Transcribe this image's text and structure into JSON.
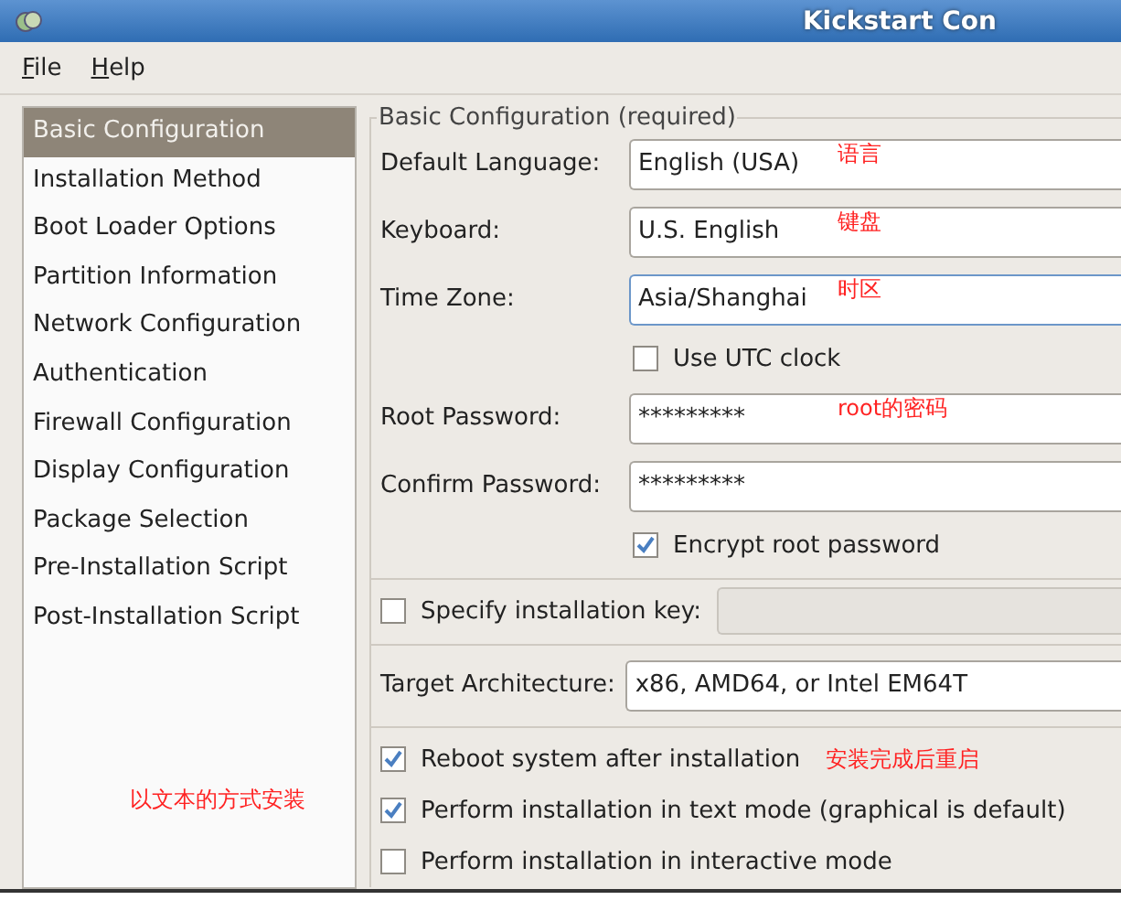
{
  "window": {
    "title": "Kickstart Con"
  },
  "menu": [
    {
      "label": "File"
    },
    {
      "label": "Help"
    }
  ],
  "sidebar": {
    "items": [
      {
        "label": "Basic Configuration",
        "selected": true
      },
      {
        "label": "Installation Method",
        "selected": false
      },
      {
        "label": "Boot Loader Options",
        "selected": false
      },
      {
        "label": "Partition Information",
        "selected": false
      },
      {
        "label": "Network Configuration",
        "selected": false
      },
      {
        "label": "Authentication",
        "selected": false
      },
      {
        "label": "Firewall Configuration",
        "selected": false
      },
      {
        "label": "Display Configuration",
        "selected": false
      },
      {
        "label": "Package Selection",
        "selected": false
      },
      {
        "label": "Pre-Installation Script",
        "selected": false
      },
      {
        "label": "Post-Installation Script",
        "selected": false
      }
    ],
    "note": "以文本的方式安装"
  },
  "section": {
    "title": "Basic Configuration (required)"
  },
  "rows": [
    {
      "kind": "field",
      "label": "Default Language:",
      "value": "English (USA)",
      "note": "语言"
    },
    {
      "kind": "field",
      "label": "Keyboard:",
      "value": "U.S. English",
      "note": "键盘"
    },
    {
      "kind": "field",
      "label": "Time Zone:",
      "value": "Asia/Shanghai",
      "note": "时区",
      "focused": true
    },
    {
      "kind": "subcheck",
      "label": "Use UTC clock",
      "checked": false
    },
    {
      "kind": "field",
      "label": "Root Password:",
      "value": "*********",
      "note": "root的密码"
    },
    {
      "kind": "field",
      "label": "Confirm Password:",
      "value": "*********"
    },
    {
      "kind": "subcheck",
      "label": "Encrypt root password",
      "checked": true
    },
    {
      "kind": "divider"
    },
    {
      "kind": "keyfield",
      "label": "Specify installation key:",
      "checked": false,
      "disabled": true
    },
    {
      "kind": "divider"
    },
    {
      "kind": "wide",
      "label": "Target Architecture:",
      "value": "x86, AMD64, or Intel EM64T"
    },
    {
      "kind": "divider"
    },
    {
      "kind": "check",
      "label": "Reboot system after installation",
      "checked": true,
      "note": "安装完成后重启"
    },
    {
      "kind": "check",
      "label": "Perform installation in text mode (graphical is default)",
      "checked": true
    },
    {
      "kind": "check",
      "label": "Perform installation in interactive mode",
      "checked": false
    }
  ]
}
